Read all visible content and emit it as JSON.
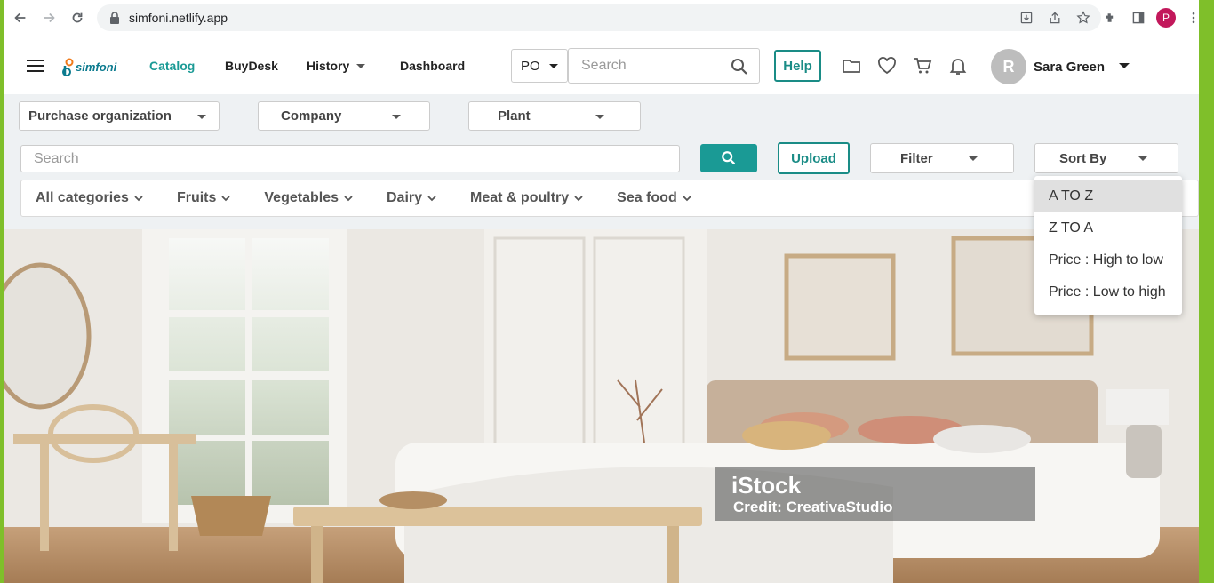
{
  "browser": {
    "url": "simfoni.netlify.app",
    "profile_initial": "P"
  },
  "header": {
    "logo_text": "simfoni",
    "nav": [
      {
        "label": "Catalog",
        "active": true
      },
      {
        "label": "BuyDesk",
        "active": false
      },
      {
        "label": "History",
        "active": false,
        "has_dropdown": true
      },
      {
        "label": "Dashboard",
        "active": false
      }
    ],
    "po_select": "PO",
    "search_placeholder": "Search",
    "help_label": "Help",
    "icons": [
      "folder-icon",
      "heart-icon",
      "cart-icon",
      "bell-icon"
    ],
    "user": {
      "initial": "R",
      "name": "Sara Green"
    }
  },
  "filters": {
    "org_selects": [
      "Purchase organization",
      "Company",
      "Plant"
    ],
    "search_placeholder": "Search",
    "upload_label": "Upload",
    "filter_label": "Filter",
    "sort_label": "Sort By"
  },
  "categories": [
    "All categories",
    "Fruits",
    "Vegetables",
    "Dairy",
    "Meat & poultry",
    "Sea food"
  ],
  "sort_menu": {
    "options": [
      "A TO Z",
      "Z TO A",
      "Price : High to low",
      "Price : Low to high"
    ],
    "selected_index": 0
  },
  "hero": {
    "watermark_brand": "iStock",
    "watermark_credit": "Credit: CreativaStudio"
  },
  "colors": {
    "accent": "#1a9a95",
    "frame": "#7fbf2a",
    "band": "#eef1f3"
  }
}
